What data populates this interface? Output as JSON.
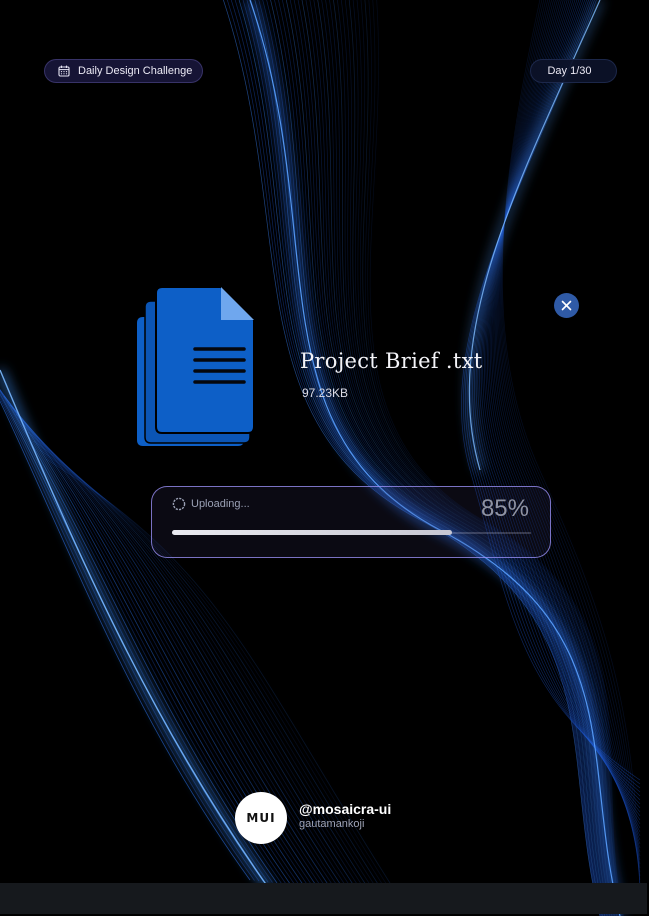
{
  "header": {
    "challenge_label": "Daily Design Challenge",
    "day_label": "Day 1/30"
  },
  "file": {
    "name": "Project  Brief .txt",
    "size": "97.23KB",
    "icon": "document-stack-icon"
  },
  "upload": {
    "status": "Uploading...",
    "percent_label": "85%",
    "progress": 0.78
  },
  "brand": {
    "logo_text": "MUI",
    "handle": "@mosaicra-ui",
    "username": "gautamankoji"
  },
  "colors": {
    "accent_blue": "#0d5fc7",
    "close_button": "#2f5aa6",
    "card_border": "#a096ff",
    "background": "#000000"
  }
}
